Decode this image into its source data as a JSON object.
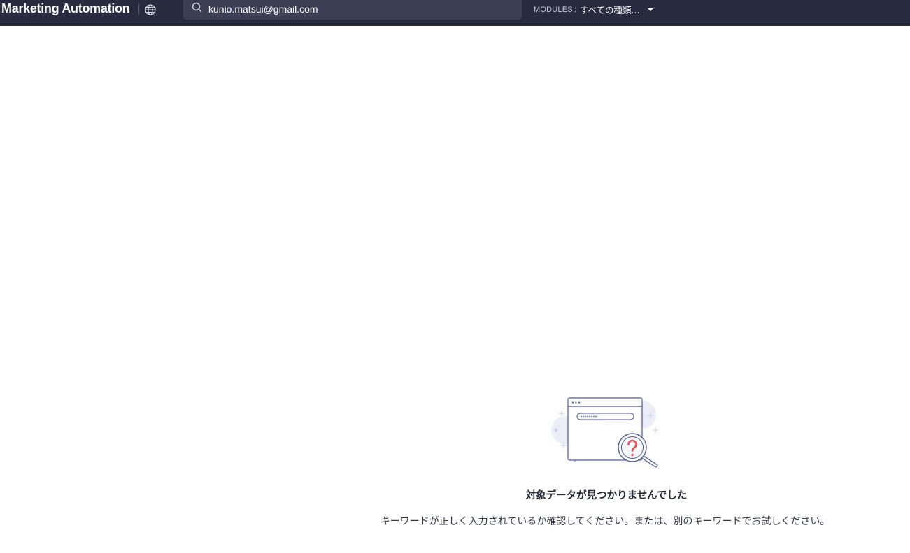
{
  "header": {
    "app_title": "Marketing Automation",
    "language_icon": "globe-icon",
    "search": {
      "icon": "search-icon",
      "value": "kunio.matsui@gmail.com",
      "placeholder": ""
    },
    "modules": {
      "label": "MODULES",
      "separator": ":",
      "selected": "すべての種類...",
      "icon": "caret-down-icon"
    }
  },
  "empty_state": {
    "illustration": "no-results-illustration",
    "title": "対象データが見つかりませんでした",
    "description": "キーワードが正しく入力されているか確認してください。または、別のキーワードでお試しください。"
  },
  "colors": {
    "header_bg": "#262b40",
    "search_bg": "#3a3f55",
    "illustration_line": "#4f5999",
    "question_mark": "#e0565b"
  }
}
